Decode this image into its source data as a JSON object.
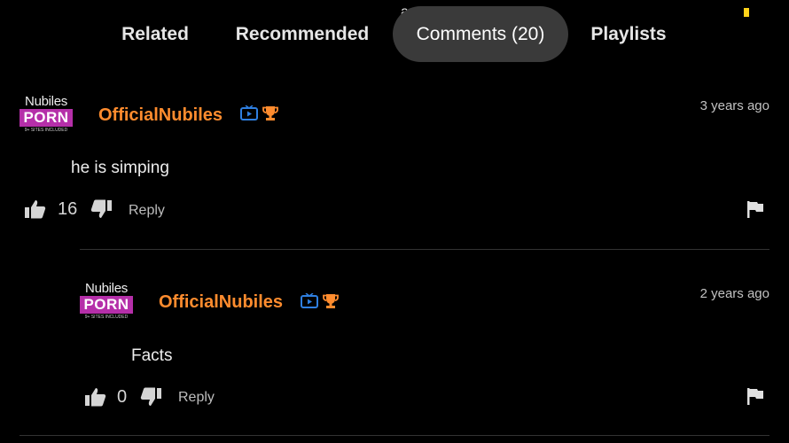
{
  "top_fragment": "am",
  "tabs": [
    {
      "label": "Related",
      "active": false
    },
    {
      "label": "Recommended",
      "active": false
    },
    {
      "label": "Comments (20)",
      "active": true
    },
    {
      "label": "Playlists",
      "active": false
    }
  ],
  "colors": {
    "background": "#000000",
    "active_tab": "#3a3a3a",
    "username": "#ff8c2e",
    "badge_tv": "#2f7fe0",
    "badge_trophy": "#ff8c2e",
    "avatar_brand": "#b52fa9",
    "status_dot": "#ffd21a"
  },
  "comments": [
    {
      "avatar": {
        "top": "Nubiles",
        "mid": "PORN",
        "bottom": "9+ SITES INCLUDED"
      },
      "username": "OfficialNubiles",
      "badges": [
        "tv-badge-icon",
        "trophy-icon"
      ],
      "time": "3 years ago",
      "text": "he is simping",
      "likes": "16",
      "reply_label": "Reply"
    },
    {
      "avatar": {
        "top": "Nubiles",
        "mid": "PORN",
        "bottom": "9+ SITES INCLUDED"
      },
      "username": "OfficialNubiles",
      "badges": [
        "tv-badge-icon",
        "trophy-icon"
      ],
      "time": "2 years ago",
      "text": "Facts",
      "likes": "0",
      "reply_label": "Reply"
    }
  ]
}
